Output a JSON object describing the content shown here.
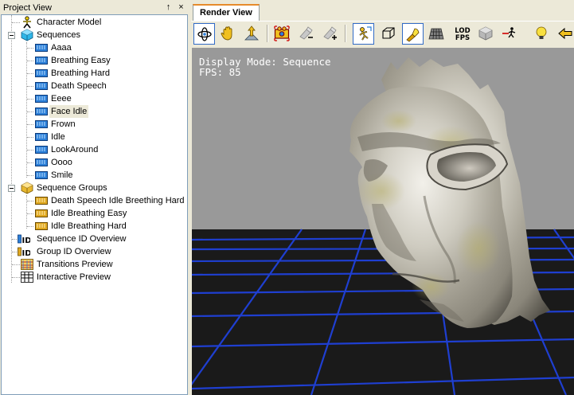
{
  "project_view": {
    "title": "Project View",
    "pin_glyph": "↑",
    "close_glyph": "×",
    "tree": {
      "character_model": "Character Model",
      "sequences": {
        "label": "Sequences",
        "items": [
          "Aaaa",
          "Breathing Easy",
          "Breathing Hard",
          "Death Speech",
          "Eeee",
          "Face Idle",
          "Frown",
          "Idle",
          "LookAround",
          "Oooo",
          "Smile"
        ],
        "selected": "Face Idle"
      },
      "sequence_groups": {
        "label": "Sequence Groups",
        "items": [
          "Death Speech Idle Breething Hard",
          "Idle Breathing Easy",
          "Idle Breathing Hard"
        ]
      },
      "sequence_id_overview": "Sequence ID Overview",
      "group_id_overview": "Group ID Overview",
      "transitions_preview": "Transitions Preview",
      "interactive_preview": "Interactive Preview"
    }
  },
  "render_view": {
    "tab_label": "Render View",
    "lod_line1": "LOD",
    "lod_line2": "FPS",
    "display_mode": "Display Mode: Sequence",
    "fps": "FPS: 85"
  },
  "colors": {
    "accent_tab": "#e68b2c",
    "grid_line": "#1f3fd1",
    "floor": "#1a1a1a",
    "sky": "#999999",
    "selection": "#ece9d8"
  },
  "icons": {
    "orbit": "orbit-icon",
    "pan": "hand-icon",
    "zoom": "zoom-icon",
    "camera": "camera-icon",
    "light": "flashlight-icon",
    "grid": "grid-icon"
  }
}
